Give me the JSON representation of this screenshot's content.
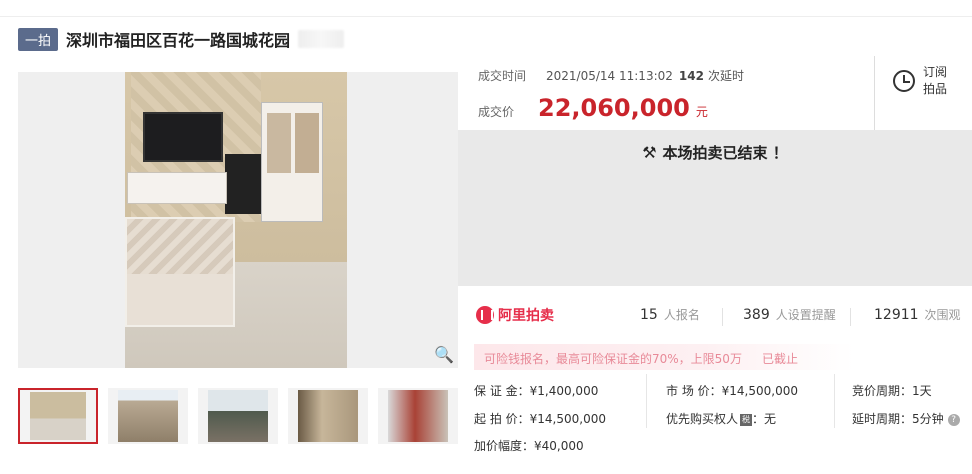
{
  "header": {
    "tag": "一拍",
    "title": "深圳市福田区百花一路国城花园"
  },
  "deal": {
    "time_label": "成交时间",
    "time": "2021/05/14 11:13:02",
    "delays": "142",
    "delays_unit": "次延时",
    "price_label": "成交价",
    "price": "22,060,000",
    "price_unit": "元"
  },
  "remind": {
    "line1": "订阅",
    "line2": "拍品"
  },
  "status": {
    "ended": "本场拍卖已结束 ！"
  },
  "stats": {
    "logo": "阿里拍卖",
    "signups": "15",
    "signups_label": "人报名",
    "reminders": "389",
    "reminders_label": "人设置提醒",
    "views": "12911",
    "views_label": "次围观"
  },
  "notice": {
    "text": "可险钱报名，最高可险保证金的70%，上限50万",
    "status": "已截止"
  },
  "params": {
    "deposit": "保 证 金：¥1,400,000",
    "start_price": "起 拍 价：¥14,500,000",
    "increment": "加价幅度：¥40,000",
    "market_price": "市 场 价：¥14,500,000",
    "priority_buyer": "优先购买权人",
    "priority_buyer_value": "：无",
    "bid_period": "竞价周期：1天",
    "delay_period": "延时周期：5分钟"
  },
  "icons": {
    "zoom": "magnifier-icon",
    "gavel": "gavel-icon",
    "alarm": "alarm-clock-icon",
    "help": "question-icon"
  },
  "colors": {
    "price": "#c9242b",
    "tag_bg": "#5b6b8c",
    "brand": "#e62e4a",
    "notice": "#e88a98"
  }
}
